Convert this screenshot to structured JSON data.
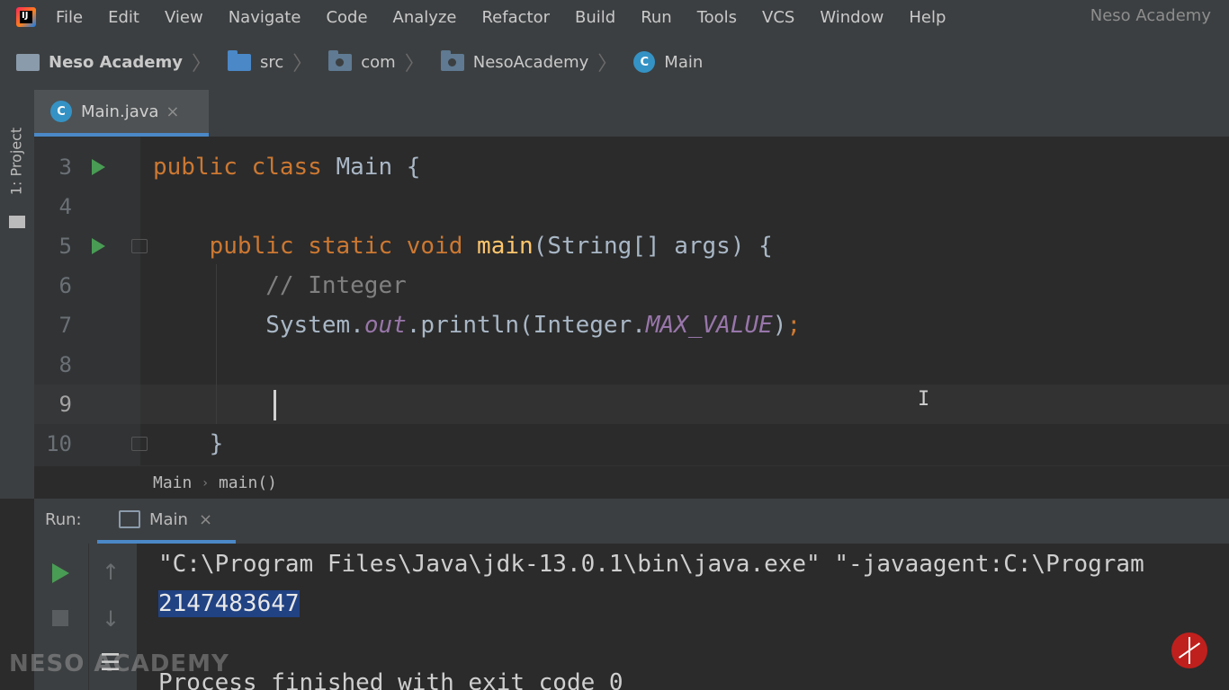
{
  "menu": {
    "items": [
      "File",
      "Edit",
      "View",
      "Navigate",
      "Code",
      "Analyze",
      "Refactor",
      "Build",
      "Run",
      "Tools",
      "VCS",
      "Window",
      "Help"
    ],
    "project_title": "Neso Academy"
  },
  "nav": {
    "project": "Neso Academy",
    "src": "src",
    "com": "com",
    "package": "NesoAcademy",
    "class": "Main"
  },
  "sidebar": {
    "project_tab": "1: Project"
  },
  "tabs": {
    "active_file": "Main.java",
    "close": "×"
  },
  "editor": {
    "lines": [
      {
        "num": "3",
        "code_html": "<span class=\"kw\">public class </span>Main {"
      },
      {
        "num": "4",
        "code_html": ""
      },
      {
        "num": "5",
        "code_html": "    <span class=\"kw\">public static void </span><span class=\"fn\">main</span>(String[] args) {"
      },
      {
        "num": "6",
        "code_html": "        <span class=\"cm\">// Integer</span>"
      },
      {
        "num": "7",
        "code_html": "        System.<span class=\"st\">out</span>.println(Integer.<span class=\"st\">MAX_VALUE</span>)<span class=\"kw\">;</span>"
      },
      {
        "num": "8",
        "code_html": ""
      },
      {
        "num": "9",
        "code_html": ""
      },
      {
        "num": "10",
        "code_html": "    }"
      }
    ],
    "breadcrumb_class": "Main",
    "breadcrumb_sep": "›",
    "breadcrumb_method": "main()"
  },
  "run_panel": {
    "label": "Run:",
    "tab": "Main",
    "close": "×",
    "console_command": "\"C:\\Program Files\\Java\\jdk-13.0.1\\bin\\java.exe\" \"-javaagent:C:\\Program",
    "console_output": "2147483647",
    "console_exit": "Process finished with exit code 0"
  },
  "watermark": "NESO ACADEMY",
  "colors": {
    "keyword": "#cc7832",
    "function": "#ffc66d",
    "comment": "#808080",
    "static_field": "#9876aa",
    "run_green": "#499c54",
    "selection": "#214283"
  }
}
